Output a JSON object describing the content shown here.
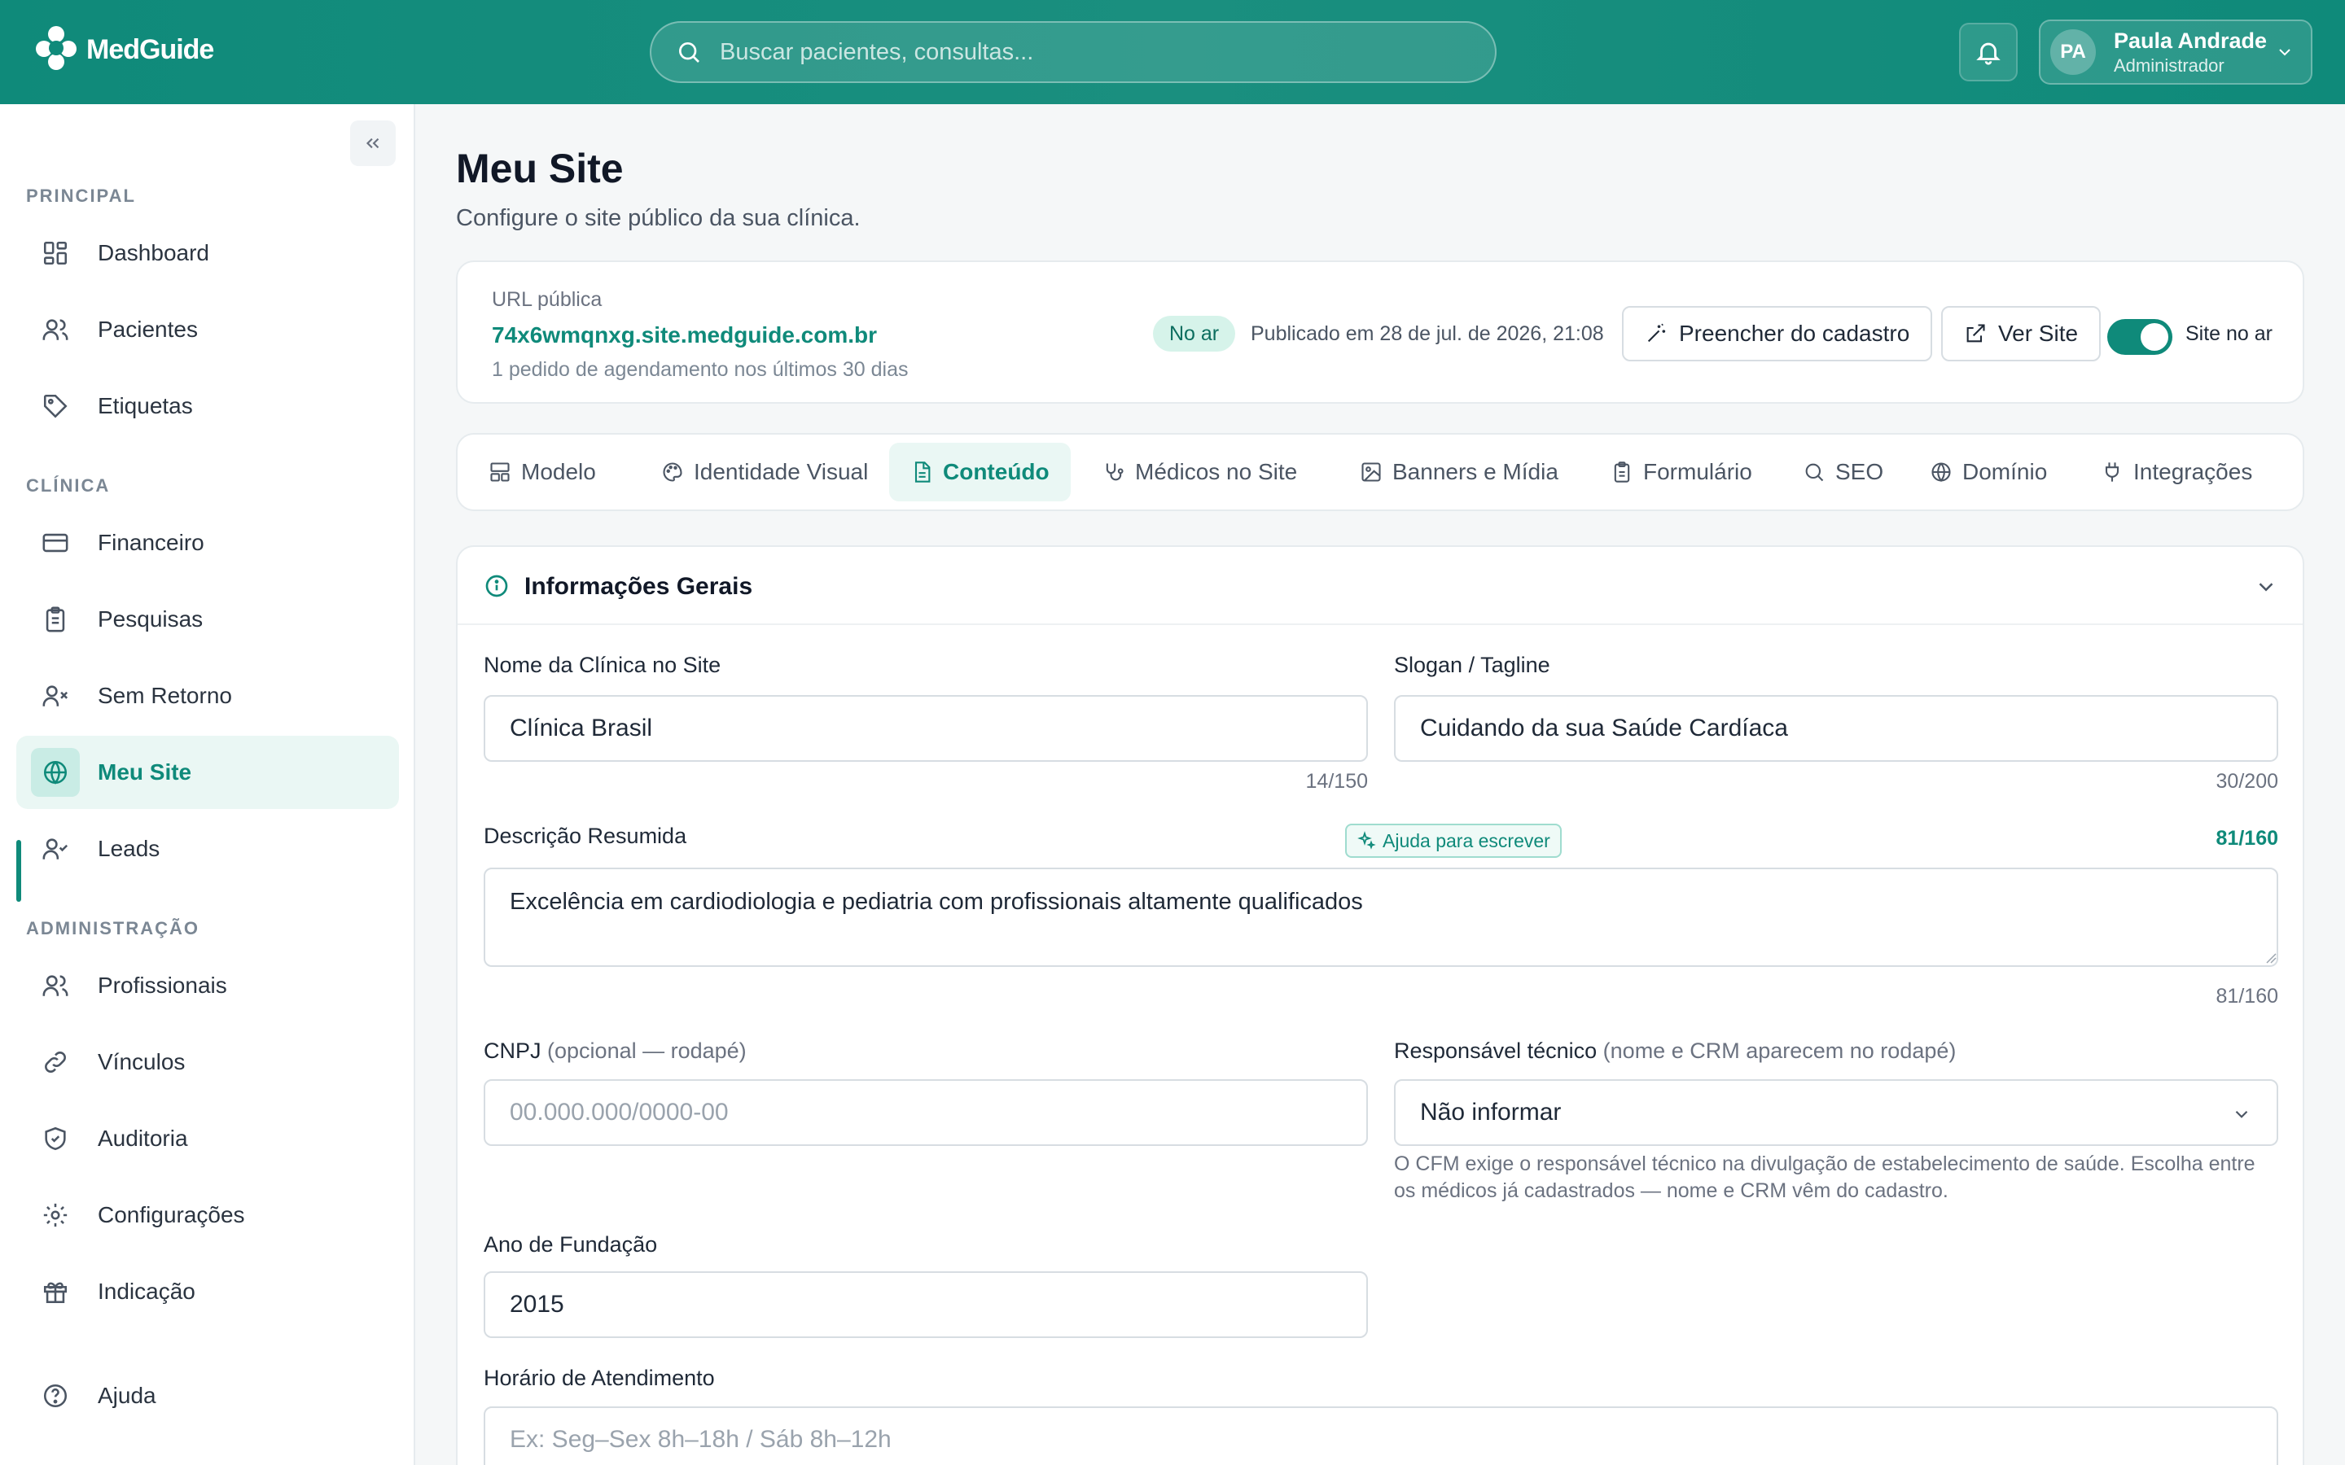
{
  "app": {
    "name": "MedGuide",
    "search_placeholder": "Buscar pacientes, consultas...",
    "user": {
      "initials": "PA",
      "name": "Paula Andrade",
      "role": "Administrador"
    }
  },
  "sidebar": {
    "sections": [
      {
        "label": "PRINCIPAL"
      },
      {
        "label": "CLÍNICA"
      },
      {
        "label": "ADMINISTRAÇÃO"
      }
    ],
    "items": [
      {
        "label": "Dashboard",
        "icon": "dashboard-icon"
      },
      {
        "label": "Pacientes",
        "icon": "users-icon"
      },
      {
        "label": "Etiquetas",
        "icon": "tag-icon"
      },
      {
        "label": "Financeiro",
        "icon": "credit-card-icon"
      },
      {
        "label": "Pesquisas",
        "icon": "clipboard-icon"
      },
      {
        "label": "Sem Retorno",
        "icon": "user-x-icon"
      },
      {
        "label": "Meu Site",
        "icon": "globe-icon",
        "active": true
      },
      {
        "label": "Leads",
        "icon": "user-check-icon"
      },
      {
        "label": "Profissionais",
        "icon": "users-icon"
      },
      {
        "label": "Vínculos",
        "icon": "link-icon"
      },
      {
        "label": "Auditoria",
        "icon": "shield-icon"
      },
      {
        "label": "Configurações",
        "icon": "gear-icon"
      },
      {
        "label": "Indicação",
        "icon": "gift-icon"
      },
      {
        "label": "Ajuda",
        "icon": "help-icon"
      }
    ]
  },
  "page": {
    "title": "Meu Site",
    "subtitle": "Configure o site público da sua clínica."
  },
  "url_card": {
    "label": "URL pública",
    "url": "74x6wmqnxg.site.medguide.com.br",
    "note": "1 pedido de agendamento nos últimos 30 dias",
    "status_badge": "No ar",
    "published": "Publicado em 28 de jul. de 2026, 21:08",
    "fill_button": "Preencher do cadastro",
    "view_button": "Ver Site",
    "toggle_label": "Site no ar",
    "toggle_on": true
  },
  "tabs": [
    {
      "label": "Modelo",
      "icon": "layout-icon"
    },
    {
      "label": "Identidade Visual",
      "icon": "palette-icon"
    },
    {
      "label": "Conteúdo",
      "icon": "file-text-icon",
      "active": true
    },
    {
      "label": "Médicos no Site",
      "icon": "stethoscope-icon"
    },
    {
      "label": "Banners e Mídia",
      "icon": "image-icon"
    },
    {
      "label": "Formulário",
      "icon": "clipboard-icon"
    },
    {
      "label": "SEO",
      "icon": "search-icon"
    },
    {
      "label": "Domínio",
      "icon": "globe-icon"
    },
    {
      "label": "Integrações",
      "icon": "plug-icon"
    }
  ],
  "panel": {
    "title": "Informações Gerais",
    "fields": {
      "clinic_name": {
        "label": "Nome da Clínica no Site",
        "value": "Clínica Brasil",
        "counter": "14/150"
      },
      "slogan": {
        "label": "Slogan / Tagline",
        "value": "Cuidando da sua Saúde Cardíaca",
        "counter": "30/200"
      },
      "description": {
        "label": "Descrição Resumida",
        "ai_button": "Ajuda para escrever",
        "counter_top": "81/160",
        "value": "Excelência em cardiodiologia e pediatria com profissionais altamente qualificados",
        "counter": "81/160"
      },
      "cnpj": {
        "label": "CNPJ",
        "label_hint": "(opcional — rodapé)",
        "placeholder": "00.000.000/0000-00",
        "value": ""
      },
      "tech_responsible": {
        "label": "Responsável técnico",
        "label_hint": "(nome e CRM aparecem no rodapé)",
        "value": "Não informar",
        "help": "O CFM exige o responsável técnico na divulgação de estabelecimento de saúde. Escolha entre os médicos já cadastrados — nome e CRM vêm do cadastro."
      },
      "founded": {
        "label": "Ano de Fundação",
        "value": "2015"
      },
      "hours": {
        "label": "Horário de Atendimento",
        "placeholder": "Ex: Seg–Sex 8h–18h / Sáb 8h–12h",
        "value": ""
      }
    }
  },
  "colors": {
    "brand": "#0f8a7a",
    "active_bg": "#eaf7f4"
  }
}
